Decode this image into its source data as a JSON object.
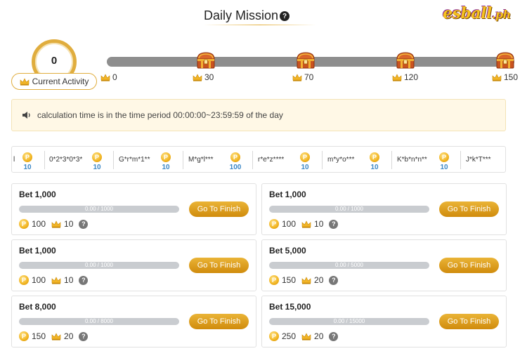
{
  "header": {
    "title": "Daily Mission",
    "help_icon": "question-circle-icon",
    "logo_text": "esball",
    "logo_suffix": ".ph"
  },
  "activity": {
    "current_value": "0",
    "current_label": "Current Activity",
    "milestones": [
      {
        "value": "0",
        "icon": "crown-icon"
      },
      {
        "value": "30",
        "icon": "treasure-chest-icon"
      },
      {
        "value": "70",
        "icon": "treasure-chest-icon"
      },
      {
        "value": "120",
        "icon": "treasure-chest-icon"
      },
      {
        "value": "150",
        "icon": "treasure-chest-icon"
      }
    ],
    "progress": 0
  },
  "notice": {
    "icon": "speaker-icon",
    "text": "calculation time is in the time period 00:00:00~23:59:59 of the day"
  },
  "ticker": [
    {
      "name": "l",
      "amount": "10"
    },
    {
      "name": "0*2*3*0*3*",
      "amount": "10"
    },
    {
      "name": "G*r*m*1**",
      "amount": "10"
    },
    {
      "name": "M*g*l***",
      "amount": "100"
    },
    {
      "name": "r*e*z****",
      "amount": "10"
    },
    {
      "name": "m*y*o***",
      "amount": "10"
    },
    {
      "name": "K*b*n*n**",
      "amount": "10"
    },
    {
      "name": "J*k*T***",
      "amount": ""
    }
  ],
  "missions": [
    {
      "title": "Bet 1,000",
      "progress_text": "0.00 / 1000",
      "progress": 0,
      "button": "Go To Finish",
      "coins": "100",
      "crowns": "10"
    },
    {
      "title": "Bet 1,000",
      "progress_text": "0.00 / 1000",
      "progress": 0,
      "button": "Go To Finish",
      "coins": "100",
      "crowns": "10"
    },
    {
      "title": "Bet 1,000",
      "progress_text": "0.00 / 1000",
      "progress": 0,
      "button": "Go To Finish",
      "coins": "100",
      "crowns": "10"
    },
    {
      "title": "Bet 5,000",
      "progress_text": "0.00 / 5000",
      "progress": 0,
      "button": "Go To Finish",
      "coins": "150",
      "crowns": "20"
    },
    {
      "title": "Bet 8,000",
      "progress_text": "0.00 / 8000",
      "progress": 0,
      "button": "Go To Finish",
      "coins": "150",
      "crowns": "20"
    },
    {
      "title": "Bet 15,000",
      "progress_text": "0.00 / 15000",
      "progress": 0,
      "button": "Go To Finish",
      "coins": "250",
      "crowns": "20"
    }
  ],
  "colors": {
    "accent_gold": "#e0ad3e",
    "button_gold": "#d08b0c",
    "track_gray": "#8e8e8e",
    "notice_bg": "#fff8e6",
    "ticker_amount_blue": "#3b87c6"
  }
}
